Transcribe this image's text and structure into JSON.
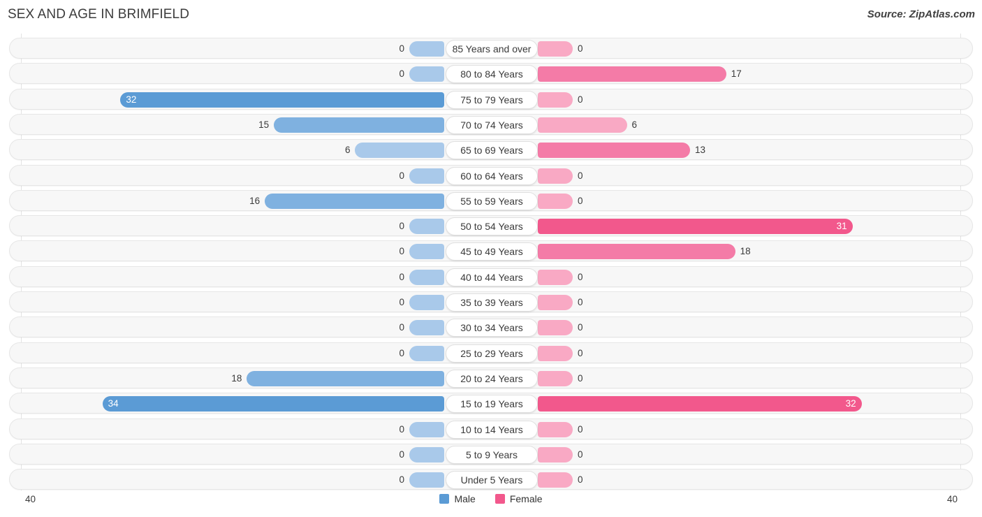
{
  "header": {
    "title": "SEX AND AGE IN BRIMFIELD",
    "source": "Source: ZipAtlas.com"
  },
  "axis": {
    "left_max_label": "40",
    "right_max_label": "40",
    "max": 40
  },
  "legend": {
    "items": [
      {
        "label": "Male",
        "color": "#5b9bd5"
      },
      {
        "label": "Female",
        "color": "#f2588c"
      }
    ]
  },
  "colors": {
    "male_dark": "#5b9bd5",
    "male_mid": "#7fb1e0",
    "male_light": "#a9c9ea",
    "female_dark": "#f2588c",
    "female_mid": "#f47ba7",
    "female_light": "#f9a9c4",
    "row_bg": "#f7f7f7",
    "row_border": "#e6e6e6",
    "axis_line": "#e3e3e3"
  },
  "chart_data": {
    "type": "bar",
    "subtype": "population-pyramid",
    "title": "SEX AND AGE IN BRIMFIELD",
    "xlabel": "",
    "ylabel": "",
    "xlim": [
      40,
      0,
      40
    ],
    "grid": false,
    "legend_position": "bottom-center",
    "categories": [
      "85 Years and over",
      "80 to 84 Years",
      "75 to 79 Years",
      "70 to 74 Years",
      "65 to 69 Years",
      "60 to 64 Years",
      "55 to 59 Years",
      "50 to 54 Years",
      "45 to 49 Years",
      "40 to 44 Years",
      "35 to 39 Years",
      "30 to 34 Years",
      "25 to 29 Years",
      "20 to 24 Years",
      "15 to 19 Years",
      "10 to 14 Years",
      "5 to 9 Years",
      "Under 5 Years"
    ],
    "series": [
      {
        "name": "Male",
        "color": "#5b9bd5",
        "values": [
          0,
          0,
          32,
          15,
          6,
          0,
          16,
          0,
          0,
          0,
          0,
          0,
          0,
          18,
          34,
          0,
          0,
          0
        ]
      },
      {
        "name": "Female",
        "color": "#f2588c",
        "values": [
          0,
          17,
          0,
          6,
          13,
          0,
          0,
          31,
          18,
          0,
          0,
          0,
          0,
          0,
          32,
          0,
          0,
          0
        ]
      }
    ]
  }
}
